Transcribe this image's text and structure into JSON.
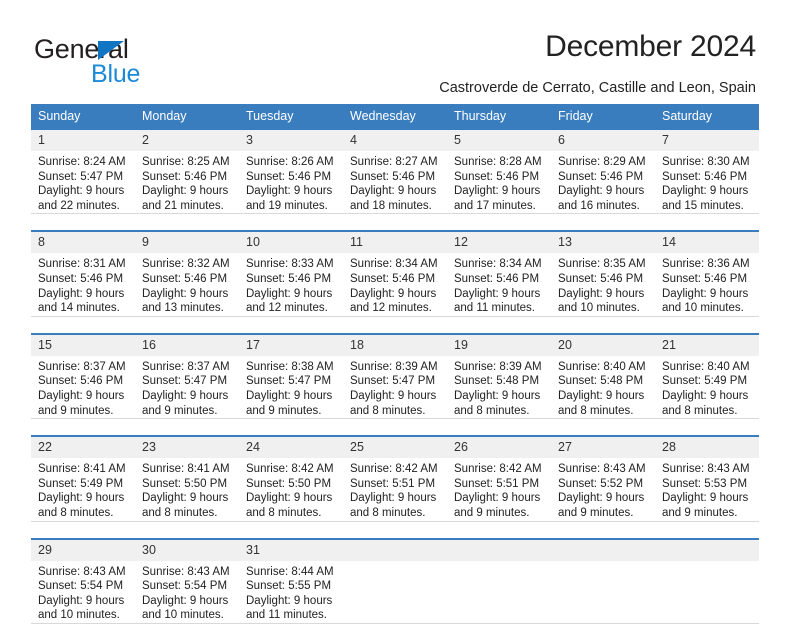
{
  "brand": {
    "name_dark": "General",
    "name_light": "Blue",
    "accent_color": "#1275c4",
    "light_color": "#1b8ad6"
  },
  "header": {
    "title": "December 2024",
    "subtitle": "Castroverde de Cerrato, Castille and Leon, Spain"
  },
  "calendar": {
    "header_bg": "#3a7dbf",
    "daynum_bg": "#f0f0f0",
    "weekdays": [
      "Sunday",
      "Monday",
      "Tuesday",
      "Wednesday",
      "Thursday",
      "Friday",
      "Saturday"
    ],
    "weeks": [
      [
        {
          "day": "1",
          "sunrise": "Sunrise: 8:24 AM",
          "sunset": "Sunset: 5:47 PM",
          "daylight1": "Daylight: 9 hours",
          "daylight2": "and 22 minutes."
        },
        {
          "day": "2",
          "sunrise": "Sunrise: 8:25 AM",
          "sunset": "Sunset: 5:46 PM",
          "daylight1": "Daylight: 9 hours",
          "daylight2": "and 21 minutes."
        },
        {
          "day": "3",
          "sunrise": "Sunrise: 8:26 AM",
          "sunset": "Sunset: 5:46 PM",
          "daylight1": "Daylight: 9 hours",
          "daylight2": "and 19 minutes."
        },
        {
          "day": "4",
          "sunrise": "Sunrise: 8:27 AM",
          "sunset": "Sunset: 5:46 PM",
          "daylight1": "Daylight: 9 hours",
          "daylight2": "and 18 minutes."
        },
        {
          "day": "5",
          "sunrise": "Sunrise: 8:28 AM",
          "sunset": "Sunset: 5:46 PM",
          "daylight1": "Daylight: 9 hours",
          "daylight2": "and 17 minutes."
        },
        {
          "day": "6",
          "sunrise": "Sunrise: 8:29 AM",
          "sunset": "Sunset: 5:46 PM",
          "daylight1": "Daylight: 9 hours",
          "daylight2": "and 16 minutes."
        },
        {
          "day": "7",
          "sunrise": "Sunrise: 8:30 AM",
          "sunset": "Sunset: 5:46 PM",
          "daylight1": "Daylight: 9 hours",
          "daylight2": "and 15 minutes."
        }
      ],
      [
        {
          "day": "8",
          "sunrise": "Sunrise: 8:31 AM",
          "sunset": "Sunset: 5:46 PM",
          "daylight1": "Daylight: 9 hours",
          "daylight2": "and 14 minutes."
        },
        {
          "day": "9",
          "sunrise": "Sunrise: 8:32 AM",
          "sunset": "Sunset: 5:46 PM",
          "daylight1": "Daylight: 9 hours",
          "daylight2": "and 13 minutes."
        },
        {
          "day": "10",
          "sunrise": "Sunrise: 8:33 AM",
          "sunset": "Sunset: 5:46 PM",
          "daylight1": "Daylight: 9 hours",
          "daylight2": "and 12 minutes."
        },
        {
          "day": "11",
          "sunrise": "Sunrise: 8:34 AM",
          "sunset": "Sunset: 5:46 PM",
          "daylight1": "Daylight: 9 hours",
          "daylight2": "and 12 minutes."
        },
        {
          "day": "12",
          "sunrise": "Sunrise: 8:34 AM",
          "sunset": "Sunset: 5:46 PM",
          "daylight1": "Daylight: 9 hours",
          "daylight2": "and 11 minutes."
        },
        {
          "day": "13",
          "sunrise": "Sunrise: 8:35 AM",
          "sunset": "Sunset: 5:46 PM",
          "daylight1": "Daylight: 9 hours",
          "daylight2": "and 10 minutes."
        },
        {
          "day": "14",
          "sunrise": "Sunrise: 8:36 AM",
          "sunset": "Sunset: 5:46 PM",
          "daylight1": "Daylight: 9 hours",
          "daylight2": "and 10 minutes."
        }
      ],
      [
        {
          "day": "15",
          "sunrise": "Sunrise: 8:37 AM",
          "sunset": "Sunset: 5:46 PM",
          "daylight1": "Daylight: 9 hours",
          "daylight2": "and 9 minutes."
        },
        {
          "day": "16",
          "sunrise": "Sunrise: 8:37 AM",
          "sunset": "Sunset: 5:47 PM",
          "daylight1": "Daylight: 9 hours",
          "daylight2": "and 9 minutes."
        },
        {
          "day": "17",
          "sunrise": "Sunrise: 8:38 AM",
          "sunset": "Sunset: 5:47 PM",
          "daylight1": "Daylight: 9 hours",
          "daylight2": "and 9 minutes."
        },
        {
          "day": "18",
          "sunrise": "Sunrise: 8:39 AM",
          "sunset": "Sunset: 5:47 PM",
          "daylight1": "Daylight: 9 hours",
          "daylight2": "and 8 minutes."
        },
        {
          "day": "19",
          "sunrise": "Sunrise: 8:39 AM",
          "sunset": "Sunset: 5:48 PM",
          "daylight1": "Daylight: 9 hours",
          "daylight2": "and 8 minutes."
        },
        {
          "day": "20",
          "sunrise": "Sunrise: 8:40 AM",
          "sunset": "Sunset: 5:48 PM",
          "daylight1": "Daylight: 9 hours",
          "daylight2": "and 8 minutes."
        },
        {
          "day": "21",
          "sunrise": "Sunrise: 8:40 AM",
          "sunset": "Sunset: 5:49 PM",
          "daylight1": "Daylight: 9 hours",
          "daylight2": "and 8 minutes."
        }
      ],
      [
        {
          "day": "22",
          "sunrise": "Sunrise: 8:41 AM",
          "sunset": "Sunset: 5:49 PM",
          "daylight1": "Daylight: 9 hours",
          "daylight2": "and 8 minutes."
        },
        {
          "day": "23",
          "sunrise": "Sunrise: 8:41 AM",
          "sunset": "Sunset: 5:50 PM",
          "daylight1": "Daylight: 9 hours",
          "daylight2": "and 8 minutes."
        },
        {
          "day": "24",
          "sunrise": "Sunrise: 8:42 AM",
          "sunset": "Sunset: 5:50 PM",
          "daylight1": "Daylight: 9 hours",
          "daylight2": "and 8 minutes."
        },
        {
          "day": "25",
          "sunrise": "Sunrise: 8:42 AM",
          "sunset": "Sunset: 5:51 PM",
          "daylight1": "Daylight: 9 hours",
          "daylight2": "and 8 minutes."
        },
        {
          "day": "26",
          "sunrise": "Sunrise: 8:42 AM",
          "sunset": "Sunset: 5:51 PM",
          "daylight1": "Daylight: 9 hours",
          "daylight2": "and 9 minutes."
        },
        {
          "day": "27",
          "sunrise": "Sunrise: 8:43 AM",
          "sunset": "Sunset: 5:52 PM",
          "daylight1": "Daylight: 9 hours",
          "daylight2": "and 9 minutes."
        },
        {
          "day": "28",
          "sunrise": "Sunrise: 8:43 AM",
          "sunset": "Sunset: 5:53 PM",
          "daylight1": "Daylight: 9 hours",
          "daylight2": "and 9 minutes."
        }
      ],
      [
        {
          "day": "29",
          "sunrise": "Sunrise: 8:43 AM",
          "sunset": "Sunset: 5:54 PM",
          "daylight1": "Daylight: 9 hours",
          "daylight2": "and 10 minutes."
        },
        {
          "day": "30",
          "sunrise": "Sunrise: 8:43 AM",
          "sunset": "Sunset: 5:54 PM",
          "daylight1": "Daylight: 9 hours",
          "daylight2": "and 10 minutes."
        },
        {
          "day": "31",
          "sunrise": "Sunrise: 8:44 AM",
          "sunset": "Sunset: 5:55 PM",
          "daylight1": "Daylight: 9 hours",
          "daylight2": "and 11 minutes."
        },
        {
          "day": "",
          "sunrise": "",
          "sunset": "",
          "daylight1": "",
          "daylight2": ""
        },
        {
          "day": "",
          "sunrise": "",
          "sunset": "",
          "daylight1": "",
          "daylight2": ""
        },
        {
          "day": "",
          "sunrise": "",
          "sunset": "",
          "daylight1": "",
          "daylight2": ""
        },
        {
          "day": "",
          "sunrise": "",
          "sunset": "",
          "daylight1": "",
          "daylight2": ""
        }
      ]
    ]
  }
}
